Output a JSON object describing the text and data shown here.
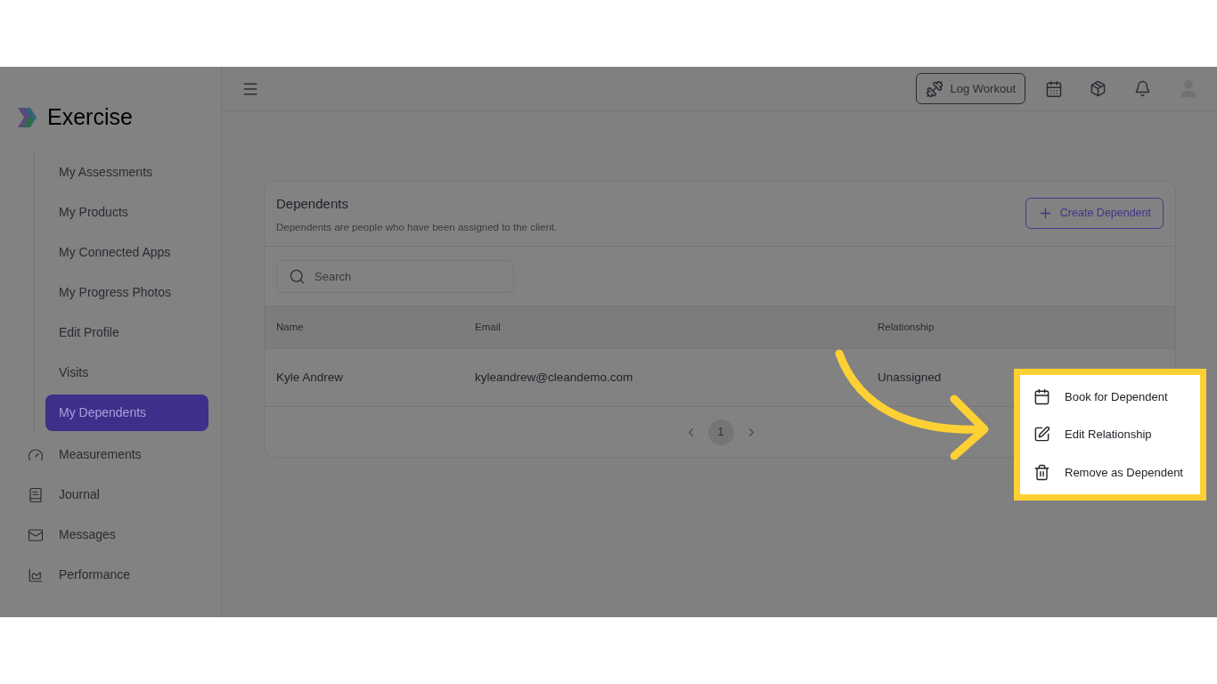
{
  "brand": {
    "name": "Exercise"
  },
  "sidebar": {
    "sub_items": [
      {
        "label": "My Assessments",
        "selected": false
      },
      {
        "label": "My Products",
        "selected": false
      },
      {
        "label": "My Connected Apps",
        "selected": false
      },
      {
        "label": "My Progress Photos",
        "selected": false
      },
      {
        "label": "Edit Profile",
        "selected": false
      },
      {
        "label": "Visits",
        "selected": false
      },
      {
        "label": "My Dependents",
        "selected": true
      }
    ],
    "items": [
      {
        "label": "Measurements",
        "selected": false
      },
      {
        "label": "Journal",
        "selected": false
      },
      {
        "label": "Messages",
        "selected": false
      },
      {
        "label": "Performance",
        "selected": false
      }
    ]
  },
  "header": {
    "log_workout": "Log Workout"
  },
  "card": {
    "title": "Dependents",
    "subtitle": "Dependents are people who have been assigned to the client.",
    "create_button": "Create Dependent",
    "search": {
      "placeholder": "Search"
    },
    "table": {
      "columns": [
        "Name",
        "Email",
        "Relationship"
      ],
      "rows": [
        {
          "name": "Kyle Andrew",
          "email": "kyleandrew@cleandemo.com",
          "relationship": "Unassigned"
        }
      ]
    },
    "pagination": [
      {
        "label": "1",
        "selected": true
      }
    ]
  },
  "menu": {
    "items": [
      {
        "label": "Book for Dependent"
      },
      {
        "label": "Edit Relationship"
      },
      {
        "label": "Remove as Dependent"
      }
    ]
  }
}
